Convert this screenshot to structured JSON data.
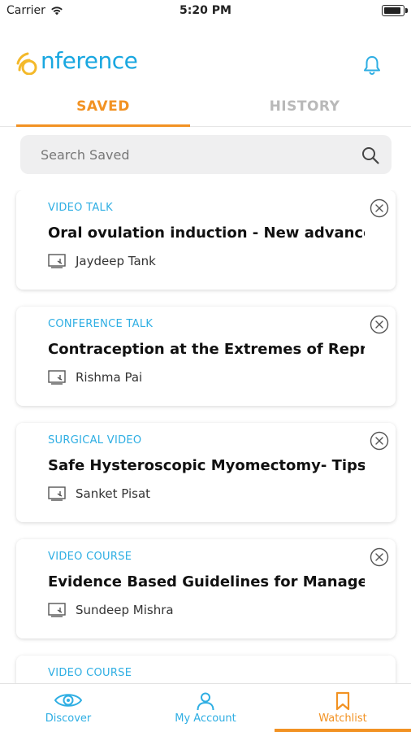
{
  "status_bar": {
    "carrier": "Carrier",
    "time": "5:20 PM"
  },
  "header": {
    "logo_letter": "O",
    "logo_text": "nference",
    "brand_color": "#19a7e0",
    "logo_accent": "#f4b92a",
    "notification_icon": "bell-icon"
  },
  "tabs": [
    {
      "label": "SAVED",
      "active": true
    },
    {
      "label": "HISTORY",
      "active": false
    }
  ],
  "search": {
    "placeholder": "Search Saved",
    "value": "",
    "icon": "search-icon"
  },
  "cards": [
    {
      "category": "VIDEO TALK",
      "title": "Oral ovulation induction - New advances",
      "author": "Jaydeep Tank"
    },
    {
      "category": "CONFERENCE TALK",
      "title": "Contraception at the Extremes of Reproductive",
      "author": "Rishma Pai"
    },
    {
      "category": "SURGICAL VIDEO",
      "title": "Safe Hysteroscopic Myomectomy- Tips & Tricks",
      "author": "Sanket Pisat"
    },
    {
      "category": "VIDEO COURSE",
      "title": "Evidence Based Guidelines for Management",
      "author": "Sundeep Mishra"
    },
    {
      "category": "VIDEO COURSE",
      "title": "",
      "author": ""
    }
  ],
  "bottom_nav": [
    {
      "label": "Discover",
      "icon": "eye-icon",
      "active": false
    },
    {
      "label": "My Account",
      "icon": "user-icon",
      "active": false
    },
    {
      "label": "Watchlist",
      "icon": "bookmark-icon",
      "active": true
    }
  ],
  "colors": {
    "accent_orange": "#f29223",
    "accent_blue": "#2eaee3",
    "inactive_tab": "#b9b9b9"
  }
}
